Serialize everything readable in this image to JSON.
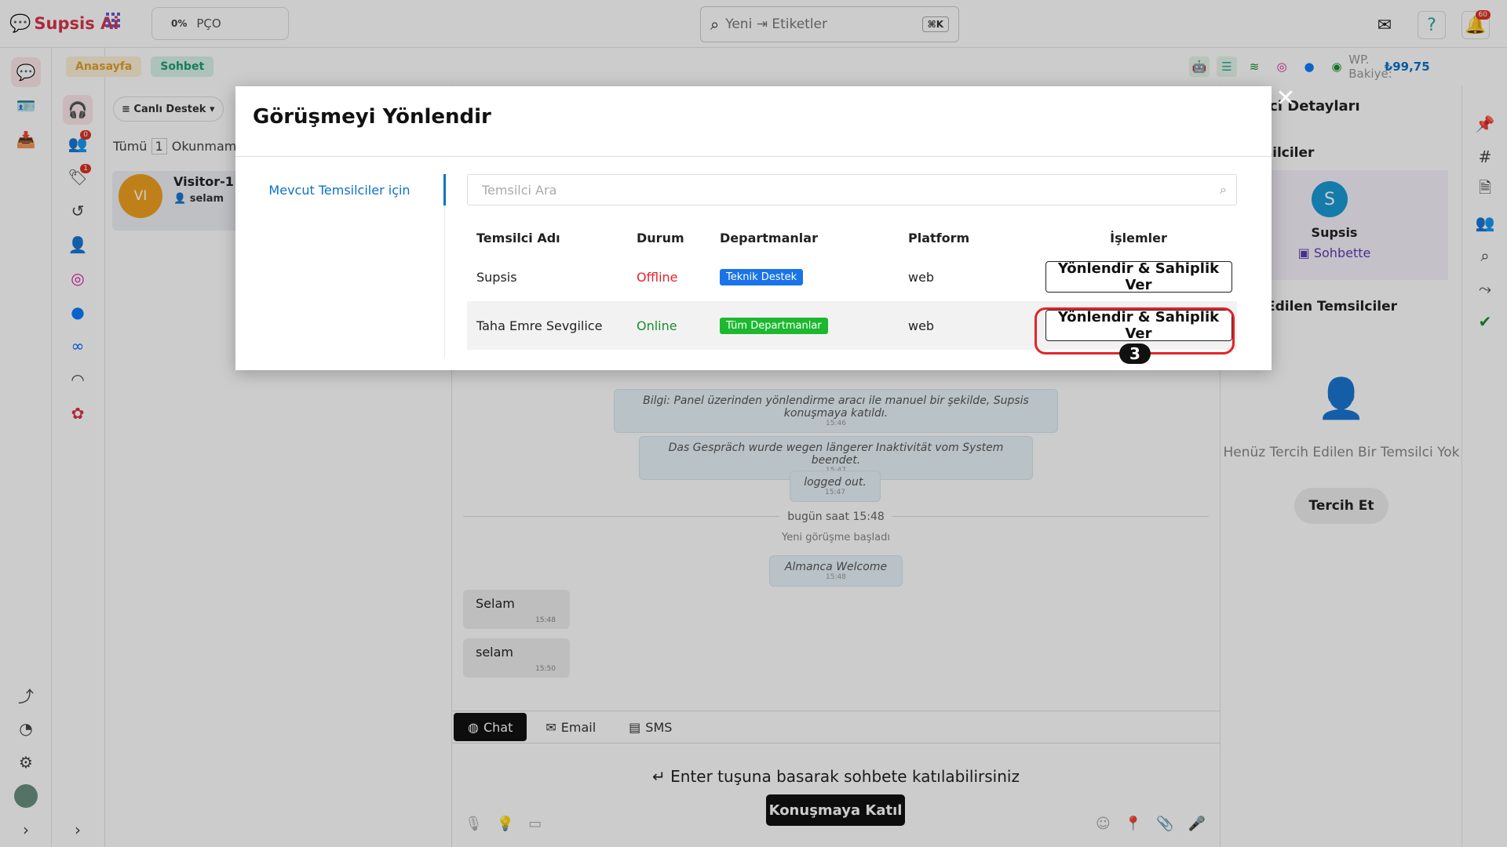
{
  "app": {
    "brand": "Supsis Ai",
    "pco_percent": "0%",
    "pco_label": "PÇO"
  },
  "search": {
    "value": "Yeni ⇥ Etiketler",
    "shortcut": "⌘K"
  },
  "top_icons": {
    "mail": "mail-icon",
    "help": "help-icon",
    "notifications": "bell-icon",
    "notification_count": "60"
  },
  "breadcrumb": {
    "home": "Anasayfa",
    "current": "Sohbet"
  },
  "wp_balance": {
    "label": "WP. Bakiye:",
    "value": "₺99,75"
  },
  "rail_badges": {
    "item_b": "0",
    "item_c": "1"
  },
  "list": {
    "filter_label": "Canlı Destek",
    "tabs": [
      {
        "label": "Tümü",
        "count": "1"
      },
      {
        "label": "Okunmam"
      }
    ],
    "visitor": {
      "initials": "VI",
      "name": "Visitor-1",
      "last": "selam"
    }
  },
  "chat": {
    "messages": [
      {
        "text": "Bilgi: Panel üzerinden yönlendirme aracı ile manuel bir şekilde, Supsis konuşmaya katıldı.",
        "time": "15:46"
      },
      {
        "text": "Das Gespräch wurde wegen längerer Inaktivität vom System beendet.",
        "time": "15:47"
      },
      {
        "text": "logged out.",
        "time": "15:47"
      }
    ],
    "divider_date": "bugün saat 15:48",
    "divider_note": "Yeni görüşme başladı",
    "welcome": {
      "text": "Almanca Welcome",
      "time": "15:48"
    },
    "bubbles": [
      {
        "text": "Selam",
        "time": "15:48"
      },
      {
        "text": "selam",
        "time": "15:50"
      }
    ],
    "tabs": [
      "Chat",
      "Email",
      "SMS"
    ],
    "hint": "Enter tuşuna basarak sohbete katılabilirsiniz",
    "join_button": "Konuşmaya Katıl"
  },
  "right_panel": {
    "title": "lci Detayları",
    "section_agents": "silciler",
    "agent_name": "Supsis",
    "agent_initial": "S",
    "agent_status": "Sohbette",
    "section_pref": "h Edilen Temsilciler",
    "empty_text": "Henüz Tercih Edilen Bir Temsilci Yok",
    "prefer_button": "Tercih Et"
  },
  "modal": {
    "title": "Görüşmeyi Yönlendir",
    "tab": "Mevcut Temsilciler için",
    "search_placeholder": "Temsilci Ara",
    "columns": [
      "Temsilci Adı",
      "Durum",
      "Departmanlar",
      "Platform",
      "İşlemler"
    ],
    "rows": [
      {
        "name": "Supsis",
        "status": "Offline",
        "status_color": "#e3242b",
        "dept": "Teknik Destek",
        "dept_color": "#1a73e8",
        "platform": "web",
        "action": "Yönlendir & Sahiplik Ver"
      },
      {
        "name": "Taha Emre Sevgilice",
        "status": "Online",
        "status_color": "#1a8f2e",
        "dept": "Tüm Departmanlar",
        "dept_color": "#1db82f",
        "platform": "web",
        "action": "Yönlendir & Sahiplik Ver"
      }
    ],
    "step_number": "3"
  }
}
